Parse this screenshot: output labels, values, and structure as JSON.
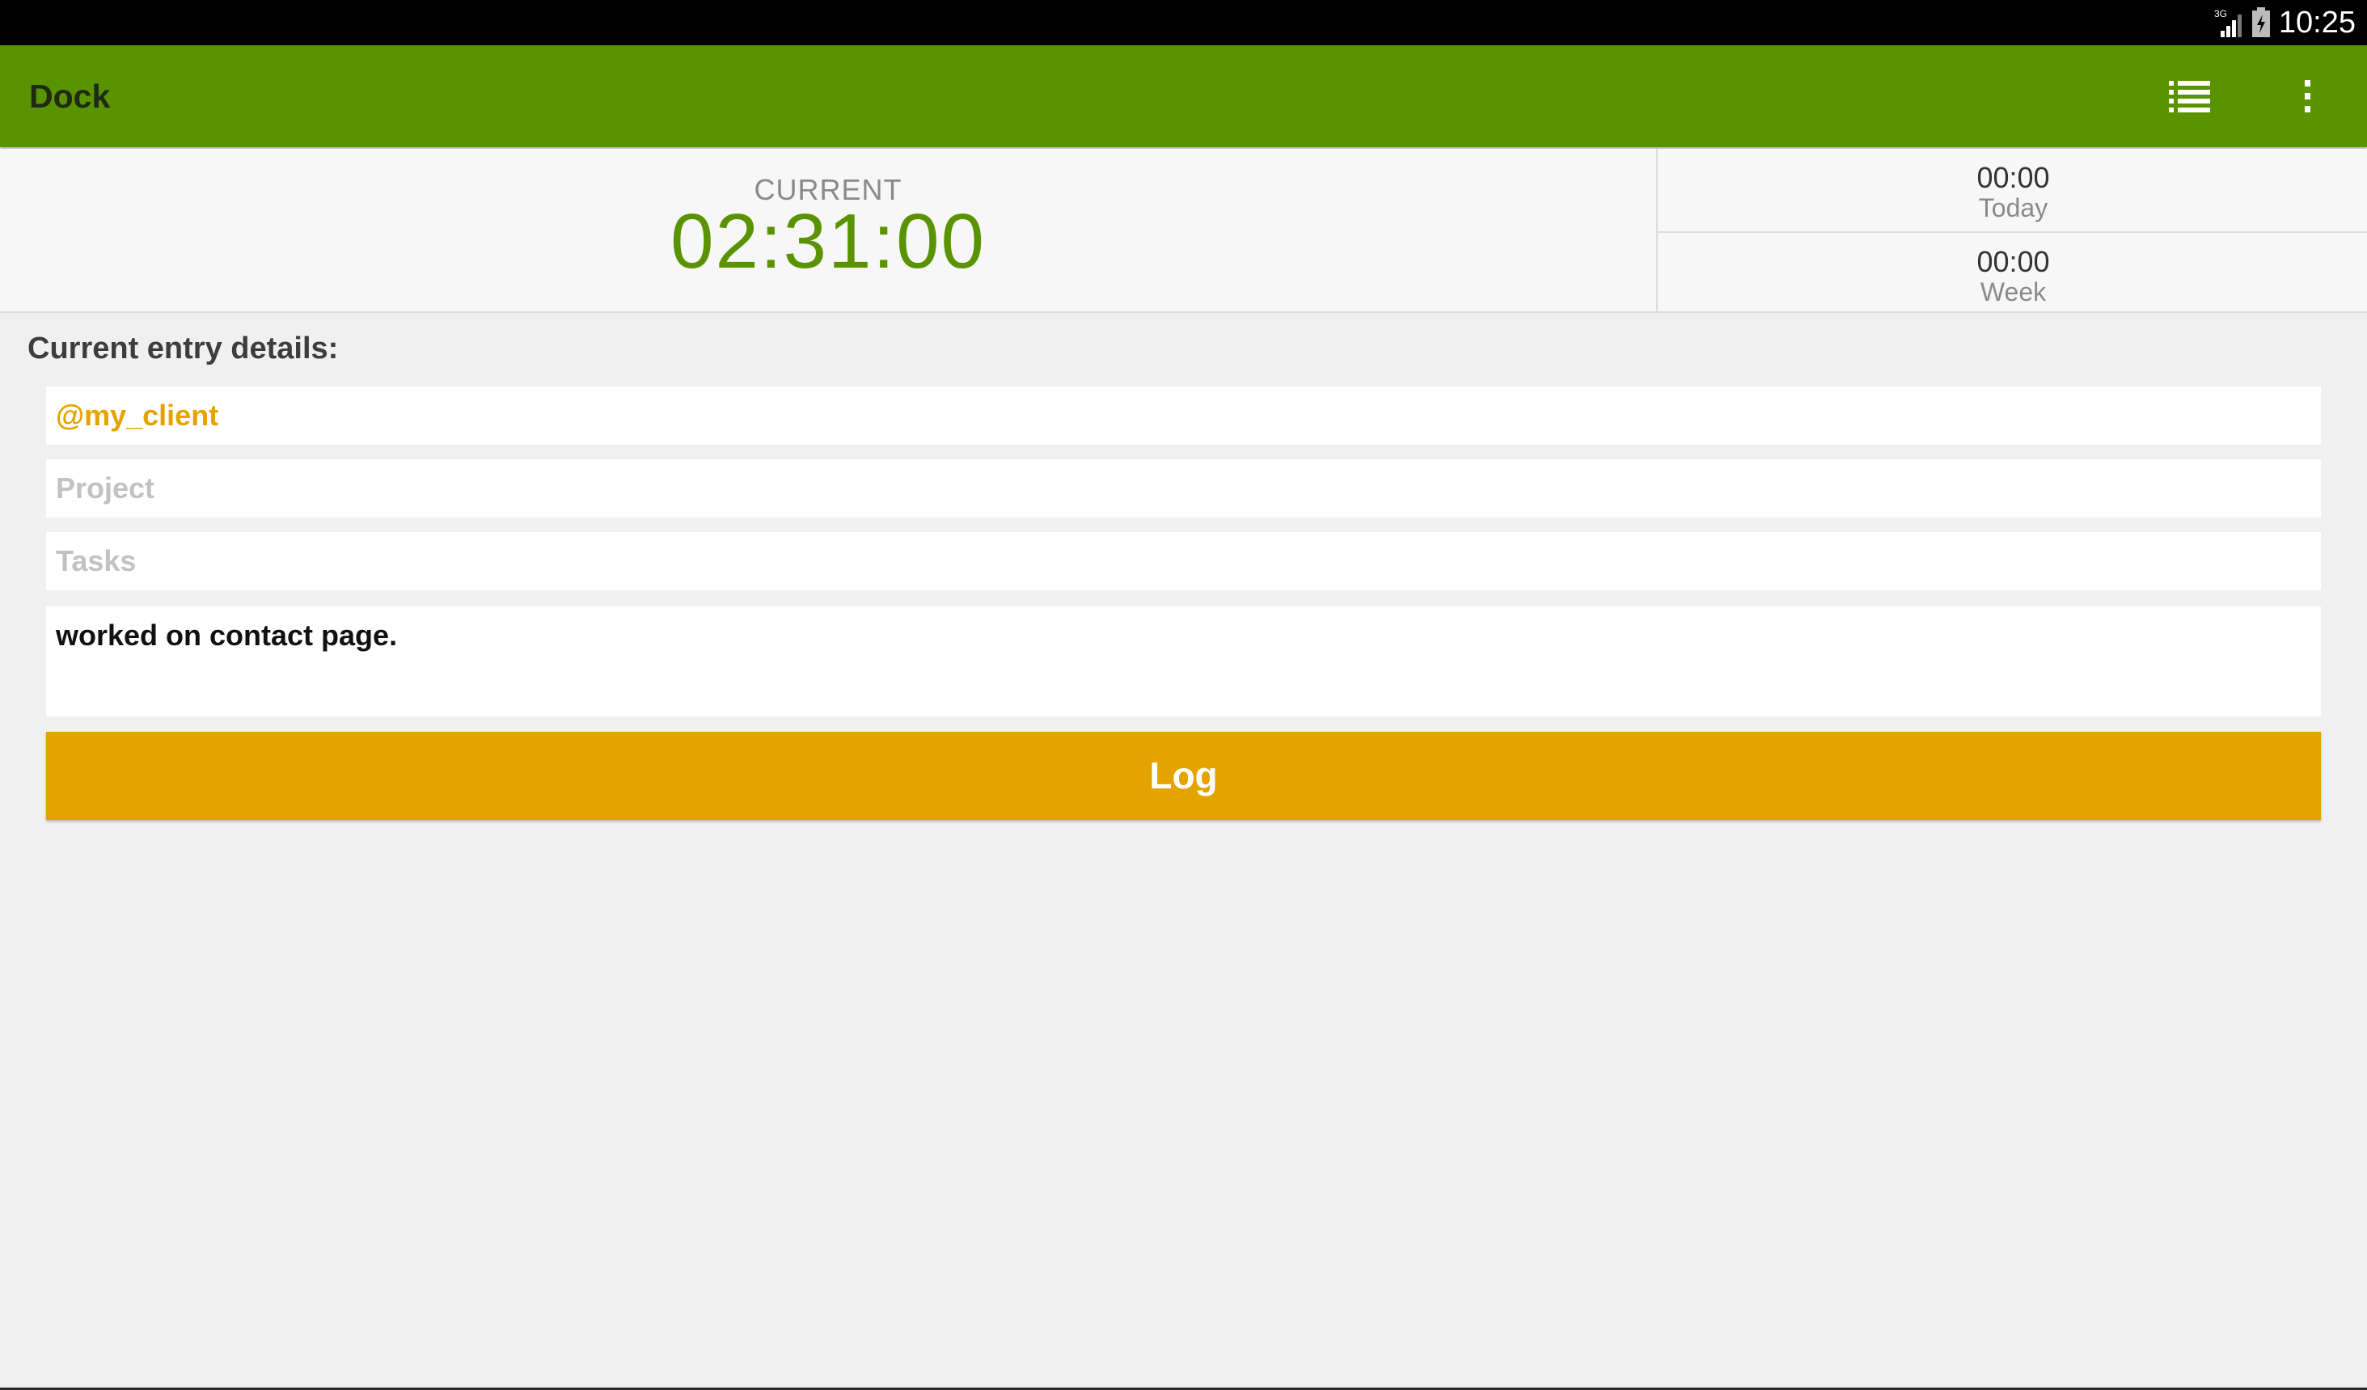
{
  "status_bar": {
    "network": "3G",
    "time": "10:25",
    "icons": [
      "signal-icon",
      "battery-icon"
    ]
  },
  "app_bar": {
    "title": "Dock",
    "actions": [
      "list-icon",
      "overflow-menu-icon"
    ],
    "color": "#5a9300"
  },
  "timer": {
    "current_label": "CURRENT",
    "current_value": "02:31:00",
    "today_value": "00:00",
    "today_label": "Today",
    "week_value": "00:00",
    "week_label": "Week"
  },
  "details": {
    "heading": "Current entry details:",
    "client_value": "@my_client",
    "project_placeholder": "Project",
    "tasks_placeholder": "Tasks",
    "notes_value": "worked on contact page."
  },
  "actions": {
    "log_label": "Log",
    "accent_color": "#e3a400"
  }
}
